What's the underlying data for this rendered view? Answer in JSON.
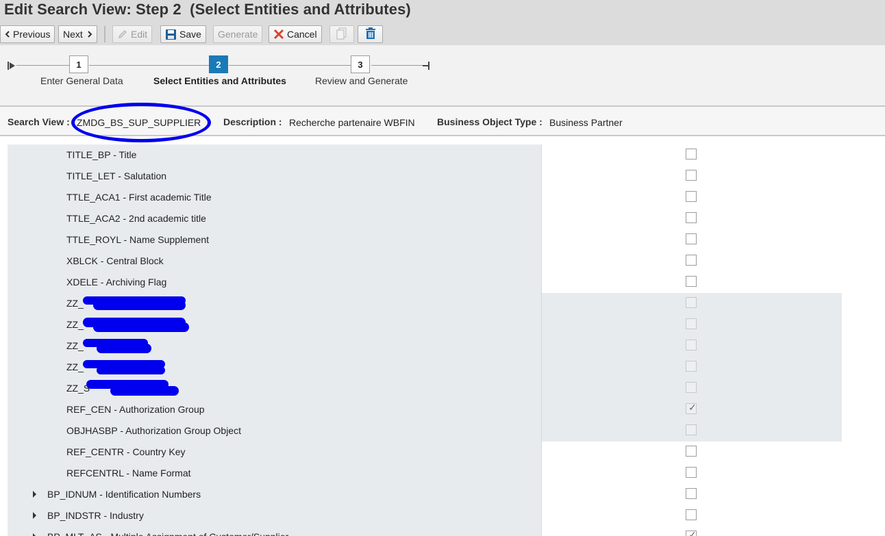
{
  "page": {
    "title": "Edit Search View: Step 2  (Select Entities and Attributes)"
  },
  "toolbar": {
    "previous": "Previous",
    "next": "Next",
    "edit": "Edit",
    "save": "Save",
    "generate": "Generate",
    "cancel": "Cancel"
  },
  "steps": [
    {
      "number": "1",
      "label": "Enter General Data",
      "active": false
    },
    {
      "number": "2",
      "label": "Select Entities and Attributes",
      "active": true
    },
    {
      "number": "3",
      "label": "Review and Generate",
      "active": false
    }
  ],
  "info": {
    "search_view_label": "Search View :",
    "search_view_value": "ZMDG_BS_SUP_SUPPLIER",
    "description_label": "Description :",
    "description_value": "Recherche partenaire WBFIN",
    "bo_type_label": "Business Object Type :",
    "bo_type_value": "Business Partner"
  },
  "rows": [
    {
      "text": "TITLE_BP - Title",
      "checked": false,
      "readonly": false
    },
    {
      "text": "TITLE_LET - Salutation",
      "checked": false,
      "readonly": false
    },
    {
      "text": "TTLE_ACA1 - First academic Title",
      "checked": false,
      "readonly": false
    },
    {
      "text": "TTLE_ACA2 - 2nd academic title",
      "checked": false,
      "readonly": false
    },
    {
      "text": "TTLE_ROYL - Name Supplement",
      "checked": false,
      "readonly": false
    },
    {
      "text": "XBLCK - Central Block",
      "checked": false,
      "readonly": false
    },
    {
      "text": "XDELE - Archiving Flag",
      "checked": false,
      "readonly": false
    },
    {
      "text": "ZZ_",
      "checked": false,
      "readonly": true,
      "redacted": true
    },
    {
      "text": "ZZ_",
      "checked": false,
      "readonly": true,
      "redacted": true
    },
    {
      "text": "ZZ_",
      "checked": false,
      "readonly": true,
      "redacted": true
    },
    {
      "text": "ZZ_",
      "checked": false,
      "readonly": true,
      "redacted": true
    },
    {
      "text": "ZZ_S",
      "checked": false,
      "readonly": true,
      "redacted": true
    },
    {
      "text": "REF_CEN - Authorization Group",
      "checked": true,
      "readonly": true
    },
    {
      "text": "OBJHASBP - Authorization Group Object",
      "checked": false,
      "readonly": true
    },
    {
      "text": "REF_CENTR - Country Key",
      "checked": false,
      "readonly": false
    },
    {
      "text": "REFCENTRL - Name Format",
      "checked": false,
      "readonly": false
    },
    {
      "text": "BP_IDNUM - Identification Numbers",
      "checked": false,
      "readonly": false,
      "expandable": true
    },
    {
      "text": "BP_INDSTR - Industry",
      "checked": false,
      "readonly": false,
      "expandable": true
    },
    {
      "text": "BP_MLT_AS - Multiple Assignment of Customer/Supplier",
      "checked": true,
      "readonly": false,
      "expandable": true
    }
  ],
  "colors": {
    "active_step": "#1a7ab8",
    "annotation": "#0000ee",
    "cancel_icon": "#d9432f",
    "save_icon": "#1f5f9a"
  }
}
